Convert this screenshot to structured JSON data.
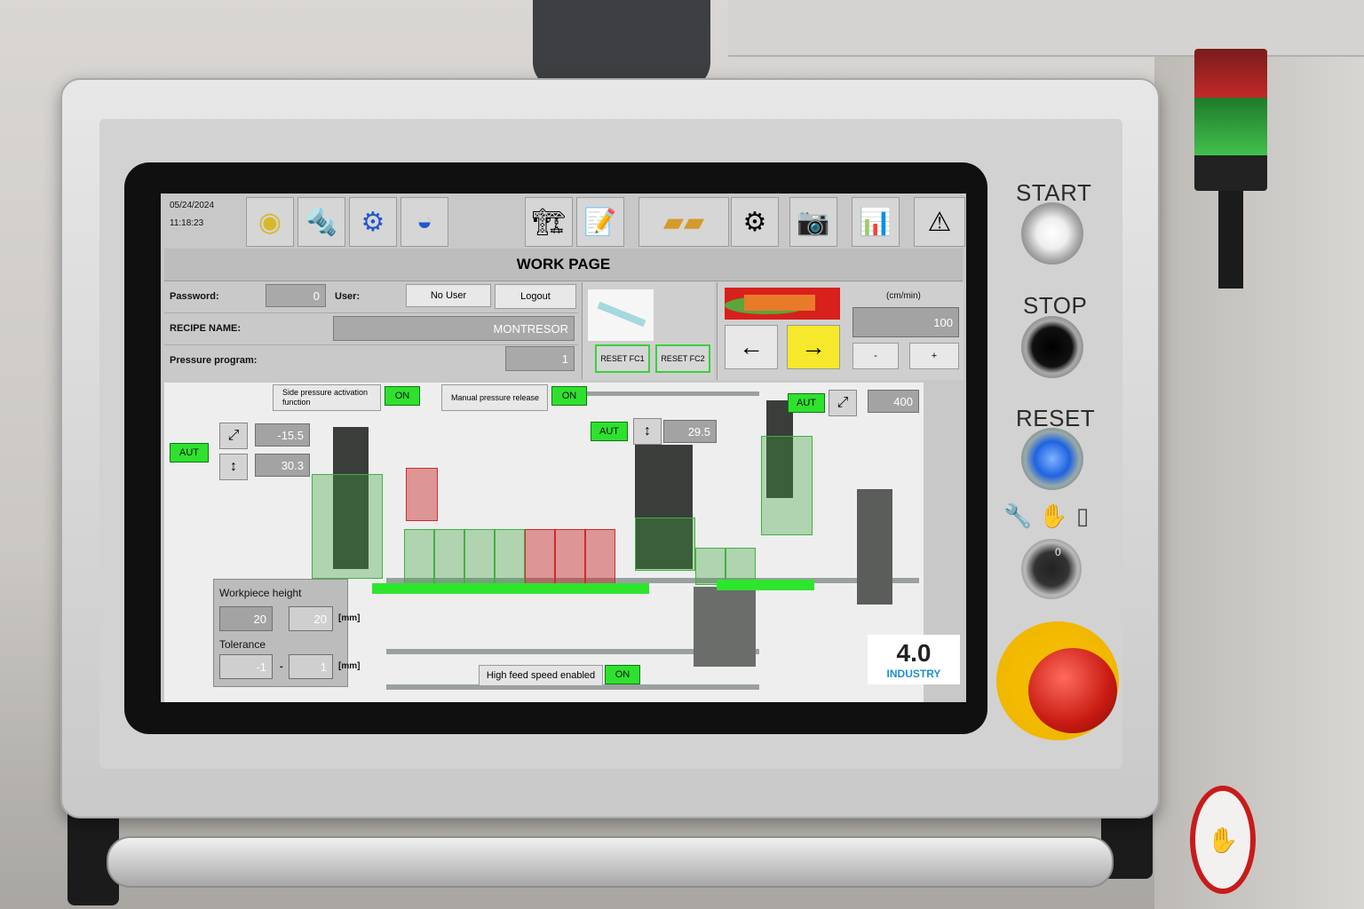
{
  "hmi": {
    "date": "05/24/2024",
    "time": "11:18:23",
    "left_toolbar": [
      "ring-part-icon",
      "tool-icon",
      "gear-badge-icon",
      "spinner-icon"
    ],
    "right_toolbar": [
      "machine-icon",
      "edit-icon",
      "wood-icon",
      "settings-icon",
      "camera-icon",
      "chart-icon",
      "warning-icon"
    ],
    "page_title": "WORK PAGE",
    "password_label": "Password:",
    "password_value": "0",
    "user_label": "User:",
    "user_value": "No User",
    "logout_label": "Logout",
    "recipe_label": "RECIPE NAME:",
    "recipe_value": "MONTRESOR",
    "pressure_label": "Pressure program:",
    "pressure_value": "1",
    "reset_fc1": "RESET FC1",
    "reset_fc2": "RESET FC2",
    "speed_unit": "(cm/min)",
    "speed_value": "100",
    "arrow_left": "←",
    "arrow_right": "→",
    "minus": "-",
    "plus": "+",
    "side_pressure_label": "Side pressure activation function",
    "side_pressure_state": "ON",
    "manual_pressure_label": "Manual pressure release",
    "manual_pressure_state": "ON",
    "aut1": "AUT",
    "aut2": "AUT",
    "aut3": "AUT",
    "value_a": "-15.5",
    "value_b": "30.3",
    "value_c": "29.5",
    "value_d": "400",
    "wp_height_label": "Workpiece height",
    "wp_height_a": "20",
    "wp_height_b": "20",
    "unit_mm": "[mm]",
    "tolerance_label": "Tolerance",
    "tol_a": "-1",
    "tol_sep": "-",
    "tol_b": "1",
    "high_feed_label": "High feed speed enabled",
    "high_feed_state": "ON",
    "logo_top": "4.0",
    "logo_bottom": "INDUSTRY"
  },
  "hardware": {
    "start_label": "START",
    "stop_label": "STOP",
    "reset_label": "RESET",
    "key_position": "0"
  },
  "colors": {
    "accent_green": "#2fe12f",
    "alarm_red": "#c81a12",
    "highlight_yellow": "#f6e82a"
  }
}
